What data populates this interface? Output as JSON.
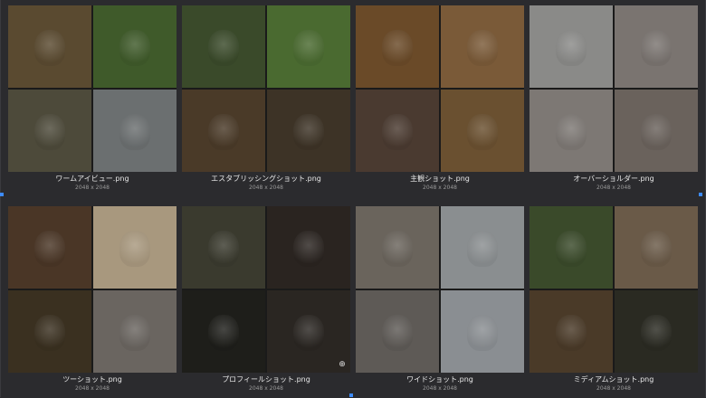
{
  "gallery": {
    "items": [
      {
        "name": "ワームアイビュー.png",
        "dims": "2048 x 2048",
        "colors": [
          "#5a4a30",
          "#3f5a2a",
          "#4d4a3a",
          "#6b6f70"
        ]
      },
      {
        "name": "エスタブリッシングショット.png",
        "dims": "2048 x 2048",
        "colors": [
          "#3a4a2a",
          "#4a6a30",
          "#4a3a28",
          "#3d3326"
        ]
      },
      {
        "name": "主観ショット.png",
        "dims": "2048 x 2048",
        "colors": [
          "#6a4a28",
          "#7a5a38",
          "#4a3a30",
          "#6a5030"
        ]
      },
      {
        "name": "オーバーショルダー.png",
        "dims": "2048 x 2048",
        "colors": [
          "#8a8a88",
          "#7a7470",
          "#7d7874",
          "#6a625c"
        ]
      },
      {
        "name": "ツーショット.png",
        "dims": "2048 x 2048",
        "colors": [
          "#4a3626",
          "#a8987e",
          "#3a3020",
          "#6a6560"
        ]
      },
      {
        "name": "プロフィールショット.png",
        "dims": "2048 x 2048",
        "colors": [
          "#3a3a2e",
          "#2a2420",
          "#1e1e1a",
          "#2a2622"
        ]
      },
      {
        "name": "ワイドショット.png",
        "dims": "2048 x 2048",
        "colors": [
          "#6a645c",
          "#8a8e90",
          "#5e5a56",
          "#8a8e92"
        ]
      },
      {
        "name": "ミディアムショット.png",
        "dims": "2048 x 2048",
        "colors": [
          "#3a4a2a",
          "#6a5a48",
          "#4a3a28",
          "#2a2a22"
        ]
      }
    ]
  }
}
